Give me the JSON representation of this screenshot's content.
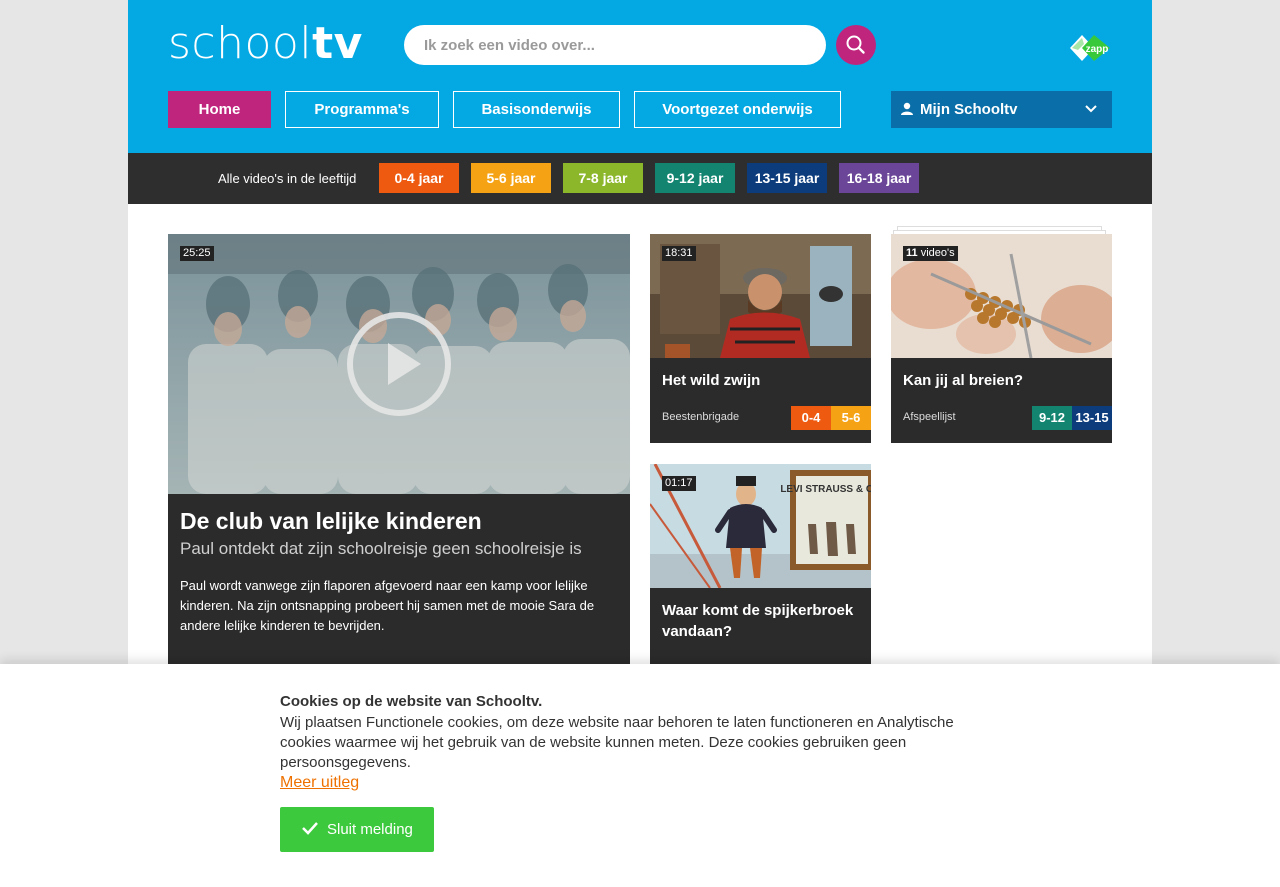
{
  "header": {
    "logo_thin": "school",
    "logo_bold": "tv",
    "search_placeholder": "Ik zoek een video over...",
    "partner_logo": "zapp",
    "nav": {
      "home": "Home",
      "programmas": "Programma's",
      "basisonderwijs": "Basisonderwijs",
      "voortgezet": "Voortgezet onderwijs",
      "mijn_schooltv": "Mijn Schooltv"
    }
  },
  "age_bar": {
    "label": "Alle video's in de leeftijd",
    "ages": [
      {
        "label": "0-4 jaar",
        "color": "#ee5a10"
      },
      {
        "label": "5-6 jaar",
        "color": "#f5a314"
      },
      {
        "label": "7-8 jaar",
        "color": "#8cb72a"
      },
      {
        "label": "9-12 jaar",
        "color": "#128470"
      },
      {
        "label": "13-15 jaar",
        "color": "#0c3c7c"
      },
      {
        "label": "16-18 jaar",
        "color": "#6b4598"
      }
    ]
  },
  "featured": {
    "duration": "25:25",
    "title": "De club van lelijke kinderen",
    "subtitle": "Paul ontdekt dat zijn schoolreisje geen schoolreisje is",
    "description": "Paul wordt vanwege zijn flaporen afgevoerd naar een kamp voor lelijke kinderen. Na zijn ontsnapping probeert hij samen met de mooie Sara de andere lelijke kinderen te bevrijden."
  },
  "cards": [
    {
      "duration": "18:31",
      "title": "Het wild zwijn",
      "program": "Beestenbrigade",
      "tags": [
        {
          "label": "0-4",
          "color": "#ee5a10"
        },
        {
          "label": "5-6",
          "color": "#f5a314"
        }
      ]
    },
    {
      "count": "11",
      "count_label": "video's",
      "title": "Kan jij al breien?",
      "program": "Afspeellijst",
      "tags": [
        {
          "label": "9-12",
          "color": "#128470"
        },
        {
          "label": "13-15",
          "color": "#0c3c7c"
        }
      ]
    },
    {
      "duration": "01:17",
      "title": "Waar komt de spijkerbroek vandaan?",
      "sign_text": "LEVI STRAUSS & CO."
    }
  ],
  "cookie": {
    "title": "Cookies op de website van Schooltv.",
    "text": "Wij plaatsen Functionele cookies, om deze website naar behoren te laten functioneren en Analytische cookies waarmee wij het gebruik van de website kunnen meten. Deze cookies gebruiken geen persoonsgegevens.",
    "link": "Meer uitleg",
    "button": "Sluit melding"
  },
  "colors": {
    "header_blue": "#04a9e4",
    "accent_magenta": "#c0257d",
    "cookie_green": "#3dc93d",
    "link_orange": "#ee7100"
  }
}
